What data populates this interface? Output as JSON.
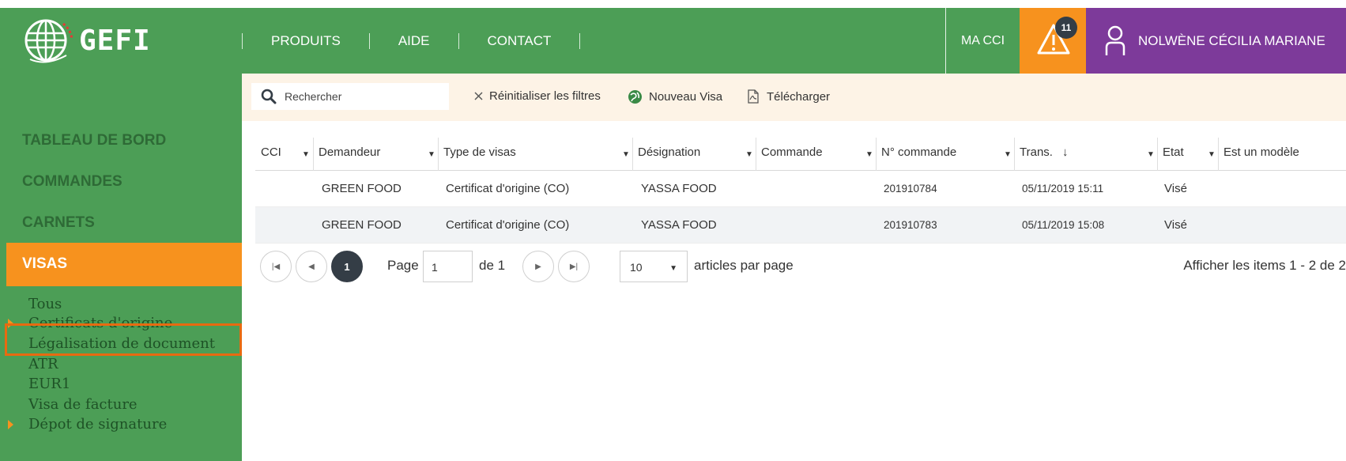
{
  "header": {
    "logo_text": "GEFI",
    "nav": [
      "PRODUITS",
      "AIDE",
      "CONTACT"
    ],
    "ma_cci": "MA CCI",
    "alert_count": "11",
    "user_name": "NOLWÈNE CÉCILIA MARIANE"
  },
  "sidebar": {
    "items": [
      "TABLEAU DE BORD",
      "COMMANDES",
      "CARNETS"
    ],
    "active": "VISAS",
    "sub_items": [
      "Tous",
      "Certificats d'origine",
      "Légalisation de document",
      "ATR",
      "EUR1",
      "Visa de facture",
      "Dépot de signature"
    ]
  },
  "toolbar": {
    "search_placeholder": "Rechercher",
    "reset_label": "Réinitialiser les filtres",
    "new_visa_label": "Nouveau Visa",
    "download_label": "Télécharger"
  },
  "table": {
    "columns": [
      "CCI",
      "Demandeur",
      "Type de visas",
      "Désignation",
      "Commande",
      "N° commande",
      "Trans.",
      "Etat",
      "Est un modèle"
    ],
    "sort_indicator": "↓",
    "rows": [
      {
        "cci": "",
        "demandeur": "GREEN FOOD",
        "type": "Certificat d'origine (CO)",
        "designation": "YASSA FOOD",
        "commande": "",
        "numero": "201910784",
        "trans": "05/11/2019 15:11",
        "etat": "Visé",
        "modele": ""
      },
      {
        "cci": "",
        "demandeur": "GREEN FOOD",
        "type": "Certificat d'origine (CO)",
        "designation": "YASSA FOOD",
        "commande": "",
        "numero": "201910783",
        "trans": "05/11/2019 15:08",
        "etat": "Visé",
        "modele": ""
      }
    ]
  },
  "pager": {
    "current_page": "1",
    "page_label": "Page",
    "page_value": "1",
    "of_label": "de 1",
    "per_page_value": "10",
    "per_page_label": "articles par page",
    "info": "Afficher les items 1 - 2 de 2"
  },
  "colors": {
    "green": "#4c9e56",
    "orange": "#f7921e",
    "purple": "#7d3a9a",
    "dark": "#343d46"
  }
}
